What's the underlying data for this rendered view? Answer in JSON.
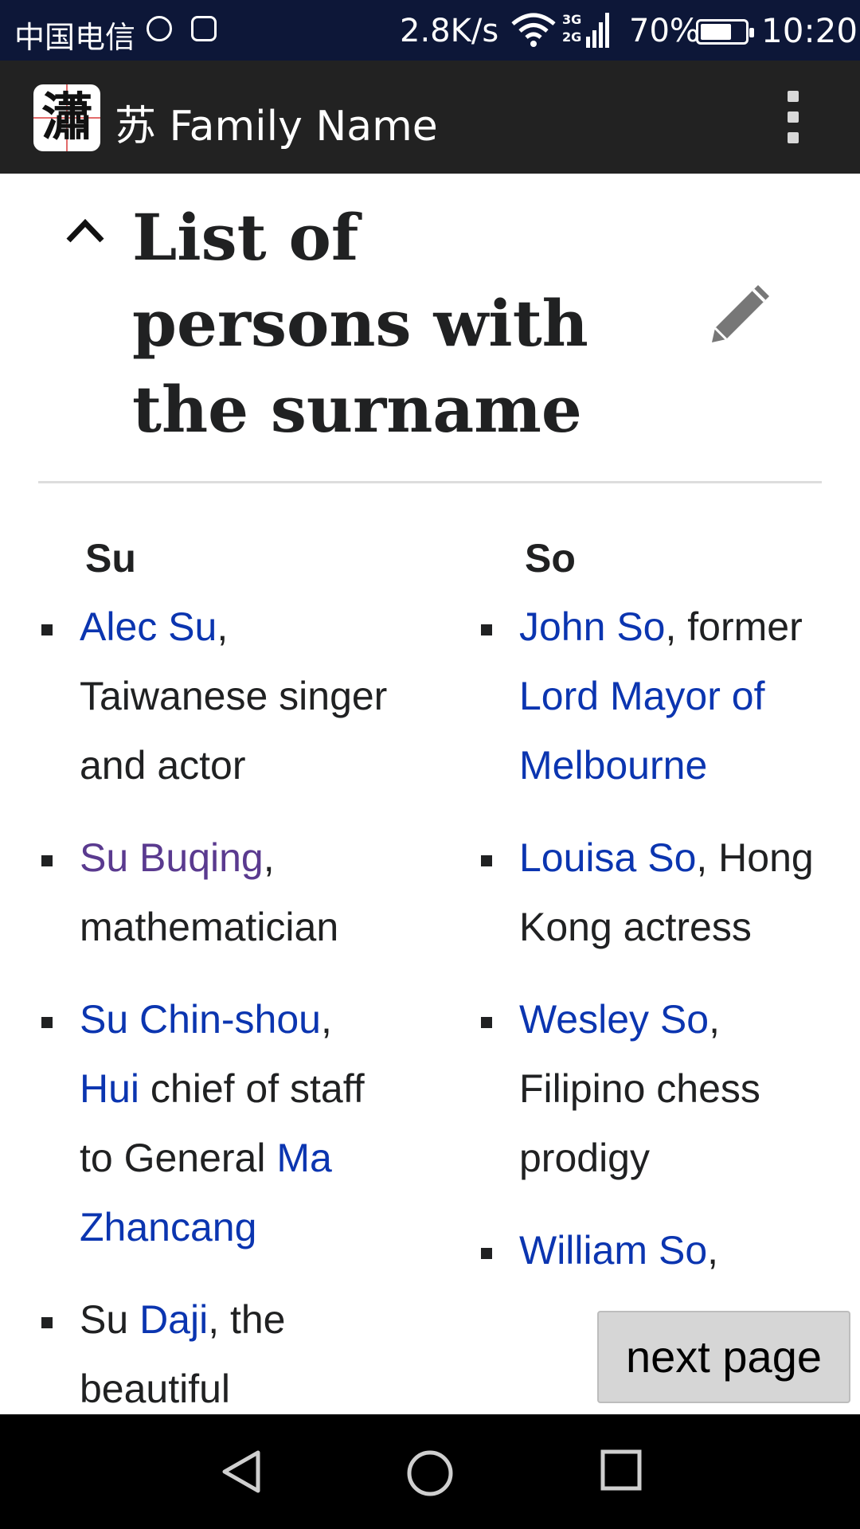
{
  "status_bar": {
    "carrier": "中国电信",
    "net_speed": "2.8K/s",
    "network_type_top": "3G",
    "network_type_bottom": "2G",
    "battery_percent": "70%",
    "battery_level": 0.7,
    "time": "10:20",
    "icons": [
      "notification-huawei-icon",
      "image-notification-icon",
      "wifi-icon",
      "signal-icon",
      "battery-icon"
    ]
  },
  "app_bar": {
    "logo_glyph": "瀟",
    "title": "苏 Family Name",
    "menu_icon": "overflow-menu-icon"
  },
  "section": {
    "heading": "List of persons with the surname",
    "collapse_icon": "chevron-up-icon",
    "edit_icon": "pencil-icon"
  },
  "columns": {
    "su": {
      "heading": "Su",
      "items": [
        {
          "link": "Alec Su",
          "text": ", Taiwanese singer and actor"
        },
        {
          "link": "Su Buqing",
          "text": ", mathematician"
        },
        {
          "link": "Su Chin-shou",
          "sep": ", ",
          "link2": "Hui",
          "mid": " chief of staff to General ",
          "link3": "Ma Zhancang"
        },
        {
          "pre": "Su ",
          "link": "Daji",
          "text": ", the beautiful concubine"
        }
      ]
    },
    "so": {
      "heading": "So",
      "items": [
        {
          "link": "John So",
          "text": ", former ",
          "link2": "Lord Mayor of Melbourne"
        },
        {
          "link": "Louisa So",
          "text": ", Hong Kong actress"
        },
        {
          "link": "Wesley So",
          "text": ", Filipino chess prodigy"
        },
        {
          "link": "William So",
          "text": ","
        }
      ]
    }
  },
  "next_page_button": "next page",
  "nav_bar": {
    "icons": [
      "back-icon",
      "home-icon",
      "recents-icon"
    ]
  },
  "colors": {
    "status_bar": "#0d1738",
    "app_bar": "#222222",
    "link": "#0b35b0",
    "visited_link": "#5a3a8f"
  }
}
